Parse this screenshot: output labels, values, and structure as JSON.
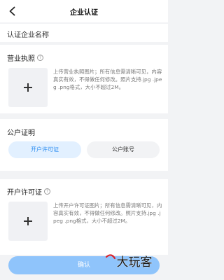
{
  "header": {
    "title": "企业认证"
  },
  "company": {
    "label": "认证企业名称"
  },
  "license": {
    "title": "营业执照",
    "hint": "上传营业执照图片；所有信息需清晰可见，内容真实有效，不得做任何修改。照片支持.jpg .jpeg .png格式，大小不超过2M。"
  },
  "cert": {
    "title": "公户证明",
    "tabs": [
      {
        "label": "开户许可证",
        "active": true
      },
      {
        "label": "公户账号",
        "active": false
      }
    ]
  },
  "permit": {
    "title": "开户许可证",
    "hint": "上传开户许可证图片；所有信息需清晰可见，内容真实有效，不得做任何修改。照片支持.jpg .jpeg .png格式，大小不超过2M。"
  },
  "footer": {
    "confirm_label": "确认"
  },
  "watermark": {
    "text": "大玩客"
  },
  "colors": {
    "accent": "#2a8cf0",
    "tab_active_bg": "#e2f0ff",
    "button_bg": "#8fc4fb",
    "page_bg": "#f2f3f5"
  },
  "icons": {
    "back": "chevron-left-icon",
    "help": "question-circle-icon",
    "upload": "plus-icon"
  }
}
